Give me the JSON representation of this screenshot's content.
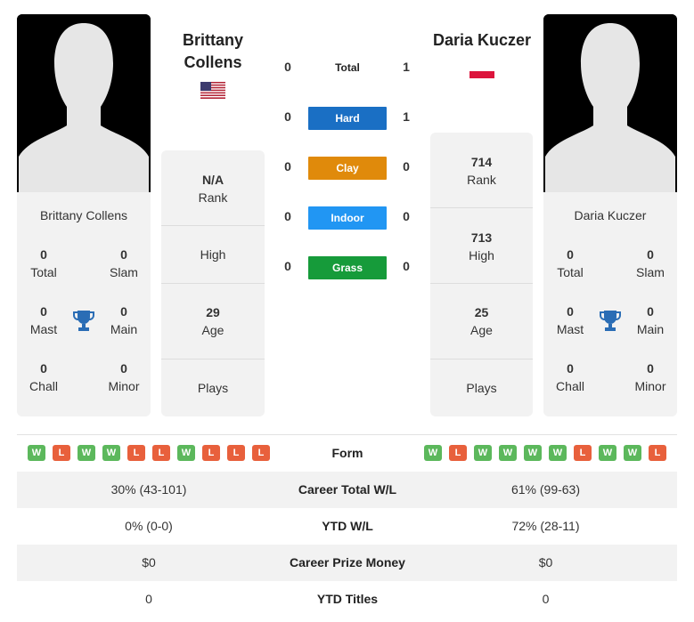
{
  "players": {
    "left": {
      "name": "Brittany Collens",
      "name_line1": "Brittany",
      "name_line2": "Collens",
      "flag": "united-states-flag",
      "rank": "N/A",
      "rank_label": "Rank",
      "high": "High",
      "age": "29",
      "age_label": "Age",
      "plays": "Plays",
      "stats": {
        "total": {
          "value": "0",
          "label": "Total"
        },
        "slam": {
          "value": "0",
          "label": "Slam"
        },
        "mast": {
          "value": "0",
          "label": "Mast"
        },
        "main": {
          "value": "0",
          "label": "Main"
        },
        "chall": {
          "value": "0",
          "label": "Chall"
        },
        "minor": {
          "value": "0",
          "label": "Minor"
        }
      }
    },
    "right": {
      "name": "Daria Kuczer",
      "flag": "poland-flag",
      "rank": "714",
      "rank_label": "Rank",
      "high": "713",
      "high_label": "High",
      "age": "25",
      "age_label": "Age",
      "plays": "Plays",
      "stats": {
        "total": {
          "value": "0",
          "label": "Total"
        },
        "slam": {
          "value": "0",
          "label": "Slam"
        },
        "mast": {
          "value": "0",
          "label": "Mast"
        },
        "main": {
          "value": "0",
          "label": "Main"
        },
        "chall": {
          "value": "0",
          "label": "Chall"
        },
        "minor": {
          "value": "0",
          "label": "Minor"
        }
      }
    }
  },
  "h2h": {
    "total": {
      "label": "Total",
      "left": "0",
      "right": "1"
    },
    "surfaces": [
      {
        "label": "Hard",
        "left": "0",
        "right": "1",
        "color": "#1a6fc4"
      },
      {
        "label": "Clay",
        "left": "0",
        "right": "0",
        "color": "#e08a0b"
      },
      {
        "label": "Indoor",
        "left": "0",
        "right": "0",
        "color": "#2196f3"
      },
      {
        "label": "Grass",
        "left": "0",
        "right": "0",
        "color": "#169b3a"
      }
    ]
  },
  "form": {
    "label": "Form",
    "left": [
      "W",
      "L",
      "W",
      "W",
      "L",
      "L",
      "W",
      "L",
      "L",
      "L"
    ],
    "right": [
      "W",
      "L",
      "W",
      "W",
      "W",
      "W",
      "L",
      "W",
      "W",
      "L"
    ]
  },
  "comparison": [
    {
      "label": "Career Total W/L",
      "left": "30% (43-101)",
      "right": "61% (99-63)"
    },
    {
      "label": "YTD W/L",
      "left": "0% (0-0)",
      "right": "72% (28-11)"
    },
    {
      "label": "Career Prize Money",
      "left": "$0",
      "right": "$0"
    },
    {
      "label": "YTD Titles",
      "left": "0",
      "right": "0"
    }
  ],
  "colors": {
    "win": "#5cb85c",
    "loss": "#e8603c",
    "trophy": "#2a6db5"
  }
}
